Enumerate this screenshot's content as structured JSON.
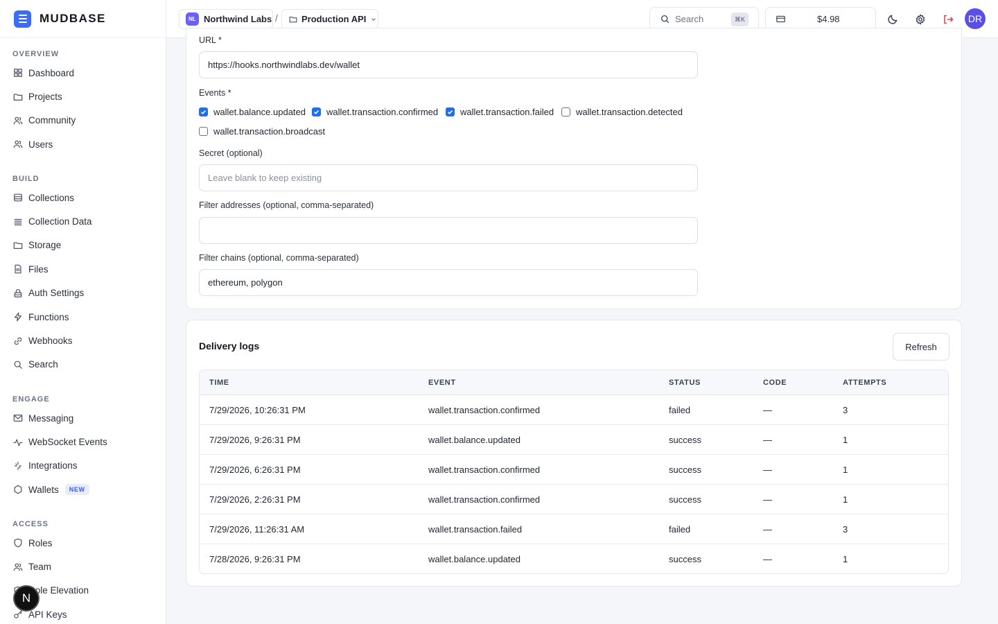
{
  "brand": {
    "name": "MUDBASE"
  },
  "sidebar": {
    "sections": [
      {
        "title": "OVERVIEW",
        "items": [
          {
            "label": "Dashboard",
            "icon": "grid-icon"
          },
          {
            "label": "Projects",
            "icon": "folder-icon"
          },
          {
            "label": "Community",
            "icon": "users-icon"
          },
          {
            "label": "Users",
            "icon": "users-icon"
          }
        ]
      },
      {
        "title": "BUILD",
        "items": [
          {
            "label": "Collections",
            "icon": "database-icon"
          },
          {
            "label": "Collection Data",
            "icon": "list-icon"
          },
          {
            "label": "Storage",
            "icon": "folder-icon"
          },
          {
            "label": "Files",
            "icon": "file-icon"
          },
          {
            "label": "Auth Settings",
            "icon": "lock-icon"
          },
          {
            "label": "Functions",
            "icon": "bolt-icon"
          },
          {
            "label": "Webhooks",
            "icon": "link-icon"
          },
          {
            "label": "Search",
            "icon": "search-icon"
          }
        ]
      },
      {
        "title": "ENGAGE",
        "items": [
          {
            "label": "Messaging",
            "icon": "mail-icon"
          },
          {
            "label": "WebSocket Events",
            "icon": "activity-icon"
          },
          {
            "label": "Integrations",
            "icon": "sparkle-icon"
          },
          {
            "label": "Wallets",
            "icon": "hexagon-icon",
            "badge": "NEW"
          }
        ]
      },
      {
        "title": "ACCESS",
        "items": [
          {
            "label": "Roles",
            "icon": "shield-icon"
          },
          {
            "label": "Team",
            "icon": "users-icon"
          },
          {
            "label": "Role Elevation",
            "icon": "shield-icon"
          },
          {
            "label": "API Keys",
            "icon": "key-icon"
          }
        ]
      }
    ],
    "floating_button": "N"
  },
  "header": {
    "org": {
      "initials": "NL",
      "name": "Northwind Labs"
    },
    "separator": "/",
    "project": {
      "name": "Production API"
    },
    "search": {
      "placeholder": "Search",
      "shortcut": "⌘K"
    },
    "balance": "$4.98",
    "user_initials": "DR"
  },
  "webhook_form": {
    "url_label": "URL *",
    "url_value": "https://hooks.northwindlabs.dev/wallet",
    "events_label": "Events *",
    "events": [
      {
        "name": "wallet.balance.updated",
        "checked": true
      },
      {
        "name": "wallet.transaction.confirmed",
        "checked": true
      },
      {
        "name": "wallet.transaction.failed",
        "checked": true
      },
      {
        "name": "wallet.transaction.detected",
        "checked": false
      },
      {
        "name": "wallet.transaction.broadcast",
        "checked": false
      }
    ],
    "secret_label": "Secret (optional)",
    "secret_placeholder": "Leave blank to keep existing",
    "filter_addresses_label": "Filter addresses (optional, comma-separated)",
    "filter_addresses_value": "",
    "filter_chains_label": "Filter chains (optional, comma-separated)",
    "filter_chains_value": "ethereum, polygon"
  },
  "delivery_logs": {
    "title": "Delivery logs",
    "refresh_label": "Refresh",
    "columns": [
      "TIME",
      "EVENT",
      "STATUS",
      "CODE",
      "ATTEMPTS"
    ],
    "rows": [
      {
        "time": "7/29/2026, 10:26:31 PM",
        "event": "wallet.transaction.confirmed",
        "status": "failed",
        "code": "—",
        "attempts": "3"
      },
      {
        "time": "7/29/2026, 9:26:31 PM",
        "event": "wallet.balance.updated",
        "status": "success",
        "code": "—",
        "attempts": "1"
      },
      {
        "time": "7/29/2026, 6:26:31 PM",
        "event": "wallet.transaction.confirmed",
        "status": "success",
        "code": "—",
        "attempts": "1"
      },
      {
        "time": "7/29/2026, 2:26:31 PM",
        "event": "wallet.transaction.confirmed",
        "status": "success",
        "code": "—",
        "attempts": "1"
      },
      {
        "time": "7/29/2026, 11:26:31 AM",
        "event": "wallet.transaction.failed",
        "status": "failed",
        "code": "—",
        "attempts": "3"
      },
      {
        "time": "7/28/2026, 9:26:31 PM",
        "event": "wallet.balance.updated",
        "status": "success",
        "code": "—",
        "attempts": "1"
      }
    ]
  },
  "colors": {
    "accent": "#3b6cf5",
    "checkbox": "#1a6ff2",
    "logout": "#e5484d",
    "avatar": "#5b4ee6"
  }
}
